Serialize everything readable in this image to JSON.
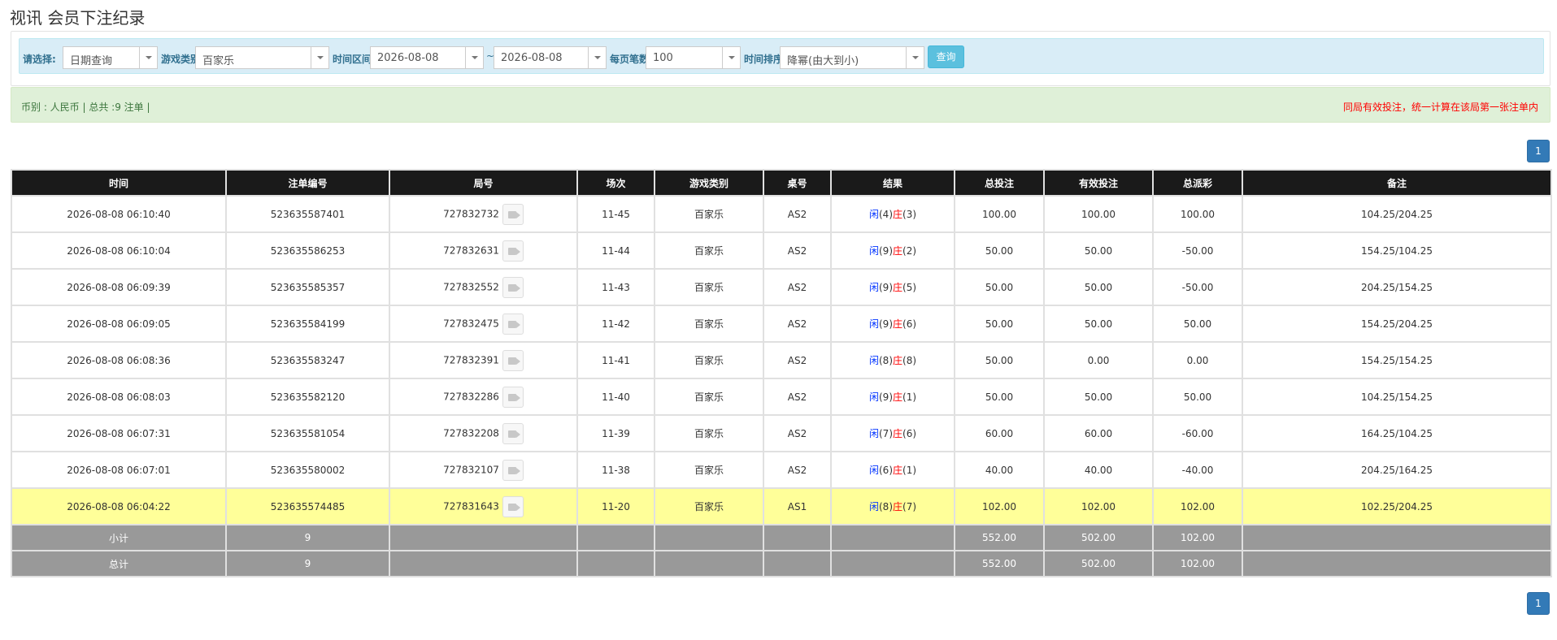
{
  "page": {
    "title": "视讯 会员下注纪录"
  },
  "filters": {
    "select_label": "请选择:",
    "select_value": "日期查询",
    "game_type_label": "游戏类别",
    "game_type_value": "百家乐",
    "time_range_label": "时间区间:",
    "start_date": "2026-08-08",
    "range_sep": "~",
    "end_date": "2026-08-08",
    "per_page_label": "每页笔数:",
    "per_page_value": "100",
    "sort_label": "时间排序:",
    "sort_value": "降幂(由大到小)",
    "query_label": "查询"
  },
  "summary": {
    "left": "币别 : 人民币 | 总共 :9 注单 |",
    "right": "同局有效投注，统一计算在该局第一张注单内"
  },
  "pagination": {
    "current": "1"
  },
  "table": {
    "headers": [
      "时间",
      "注单编号",
      "局号",
      "场次",
      "游戏类别",
      "桌号",
      "结果",
      "总投注",
      "有效投注",
      "总派彩",
      "备注"
    ],
    "rows": [
      {
        "time": "2026-08-08 06:10:40",
        "bet_id": "523635587401",
        "round": "727832732",
        "session": "11-45",
        "game": "百家乐",
        "table": "AS2",
        "player_label": "闲",
        "player_score": "(4)",
        "banker_label": "庄",
        "banker_score": "(3)",
        "total_bet": "100.00",
        "valid_bet": "100.00",
        "payout": "100.00",
        "payout_neg": false,
        "remark": "104.25/204.25",
        "highlight": false
      },
      {
        "time": "2026-08-08 06:10:04",
        "bet_id": "523635586253",
        "round": "727832631",
        "session": "11-44",
        "game": "百家乐",
        "table": "AS2",
        "player_label": "闲",
        "player_score": "(9)",
        "banker_label": "庄",
        "banker_score": "(2)",
        "total_bet": "50.00",
        "valid_bet": "50.00",
        "payout": "-50.00",
        "payout_neg": true,
        "remark": "154.25/104.25",
        "highlight": false
      },
      {
        "time": "2026-08-08 06:09:39",
        "bet_id": "523635585357",
        "round": "727832552",
        "session": "11-43",
        "game": "百家乐",
        "table": "AS2",
        "player_label": "闲",
        "player_score": "(9)",
        "banker_label": "庄",
        "banker_score": "(5)",
        "total_bet": "50.00",
        "valid_bet": "50.00",
        "payout": "-50.00",
        "payout_neg": true,
        "remark": "204.25/154.25",
        "highlight": false
      },
      {
        "time": "2026-08-08 06:09:05",
        "bet_id": "523635584199",
        "round": "727832475",
        "session": "11-42",
        "game": "百家乐",
        "table": "AS2",
        "player_label": "闲",
        "player_score": "(9)",
        "banker_label": "庄",
        "banker_score": "(6)",
        "total_bet": "50.00",
        "valid_bet": "50.00",
        "payout": "50.00",
        "payout_neg": false,
        "remark": "154.25/204.25",
        "highlight": false
      },
      {
        "time": "2026-08-08 06:08:36",
        "bet_id": "523635583247",
        "round": "727832391",
        "session": "11-41",
        "game": "百家乐",
        "table": "AS2",
        "player_label": "闲",
        "player_score": "(8)",
        "banker_label": "庄",
        "banker_score": "(8)",
        "total_bet": "50.00",
        "valid_bet": "0.00",
        "payout": "0.00",
        "payout_neg": false,
        "remark": "154.25/154.25",
        "highlight": false
      },
      {
        "time": "2026-08-08 06:08:03",
        "bet_id": "523635582120",
        "round": "727832286",
        "session": "11-40",
        "game": "百家乐",
        "table": "AS2",
        "player_label": "闲",
        "player_score": "(9)",
        "banker_label": "庄",
        "banker_score": "(1)",
        "total_bet": "50.00",
        "valid_bet": "50.00",
        "payout": "50.00",
        "payout_neg": false,
        "remark": "104.25/154.25",
        "highlight": false
      },
      {
        "time": "2026-08-08 06:07:31",
        "bet_id": "523635581054",
        "round": "727832208",
        "session": "11-39",
        "game": "百家乐",
        "table": "AS2",
        "player_label": "闲",
        "player_score": "(7)",
        "banker_label": "庄",
        "banker_score": "(6)",
        "total_bet": "60.00",
        "valid_bet": "60.00",
        "payout": "-60.00",
        "payout_neg": true,
        "remark": "164.25/104.25",
        "highlight": false
      },
      {
        "time": "2026-08-08 06:07:01",
        "bet_id": "523635580002",
        "round": "727832107",
        "session": "11-38",
        "game": "百家乐",
        "table": "AS2",
        "player_label": "闲",
        "player_score": "(6)",
        "banker_label": "庄",
        "banker_score": "(1)",
        "total_bet": "40.00",
        "valid_bet": "40.00",
        "payout": "-40.00",
        "payout_neg": true,
        "remark": "204.25/164.25",
        "highlight": false
      },
      {
        "time": "2026-08-08 06:04:22",
        "bet_id": "523635574485",
        "round": "727831643",
        "session": "11-20",
        "game": "百家乐",
        "table": "AS1",
        "player_label": "闲",
        "player_score": "(8)",
        "banker_label": "庄",
        "banker_score": "(7)",
        "total_bet": "102.00",
        "valid_bet": "102.00",
        "payout": "102.00",
        "payout_neg": false,
        "remark": "102.25/204.25",
        "highlight": true
      }
    ],
    "subtotal": {
      "label": "小计",
      "count": "9",
      "total_bet": "552.00",
      "valid_bet": "502.00",
      "payout": "102.00"
    },
    "total": {
      "label": "总计",
      "count": "9",
      "total_bet": "552.00",
      "valid_bet": "502.00",
      "payout": "102.00"
    }
  },
  "colors": {
    "header_bg": "#1a1a1a",
    "highlight_row": "#ffff99",
    "summary_row": "#999999",
    "positive_amount": "#0033ff",
    "negative_amount": "#ff0000",
    "info_bar": "#d9edf7",
    "success_bar": "#dff0d8",
    "primary": "#337ab7"
  }
}
